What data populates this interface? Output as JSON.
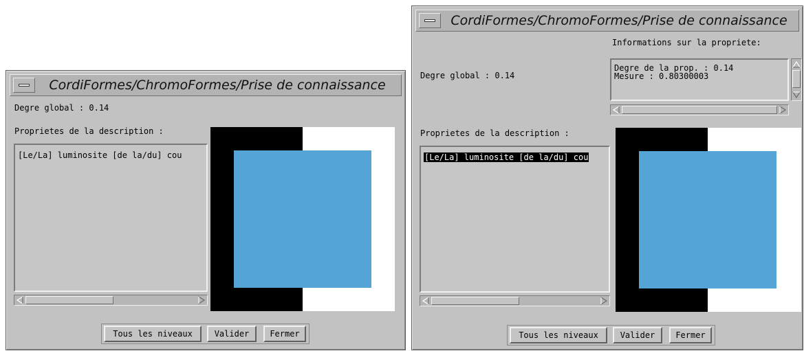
{
  "colors": {
    "window_bg": "#c2c2c2",
    "preview_blue": "#55a4d6",
    "preview_black": "#000000",
    "preview_white": "#ffffff"
  },
  "window_left": {
    "title": "CordiFormes/ChromoFormes/Prise de connaissance",
    "global_degree": "Degre global : 0.14",
    "properties_label": "Proprietes de la description :",
    "list_items": [
      {
        "label": "[Le/La] luminosite [de la/du] cou",
        "selected": false
      }
    ],
    "buttons": {
      "all_levels": "Tous les niveaux",
      "validate": "Valider",
      "close": "Fermer"
    }
  },
  "window_right": {
    "title": "CordiFormes/ChromoFormes/Prise de connaissance",
    "global_degree": "Degre global : 0.14",
    "info_label": "Informations sur la propriete:",
    "info_lines": [
      "Degre de la prop. : 0.14",
      "Mesure : 0.80300003"
    ],
    "properties_label": "Proprietes de la description :",
    "list_items": [
      {
        "label": "[Le/La] luminosite [de la/du] cou",
        "selected": true
      }
    ],
    "buttons": {
      "all_levels": "Tous les niveaux",
      "validate": "Valider",
      "close": "Fermer"
    }
  }
}
